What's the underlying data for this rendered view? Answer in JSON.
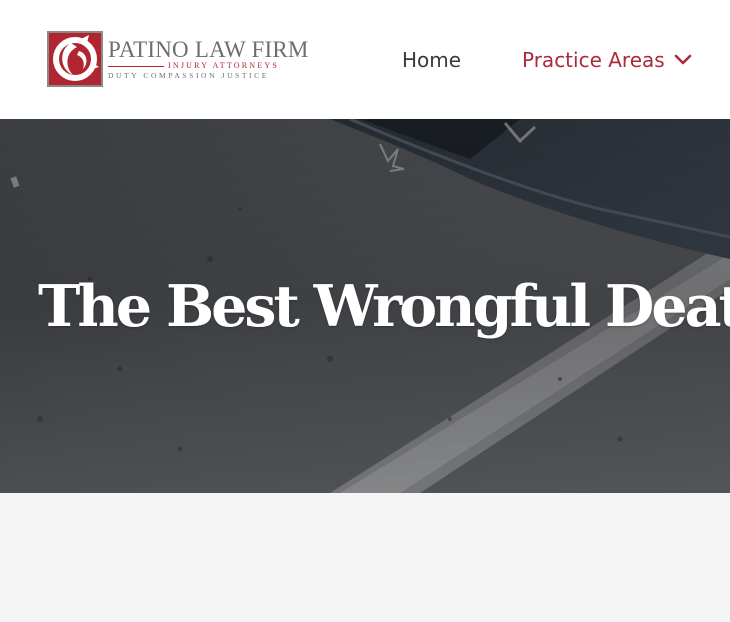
{
  "header": {
    "logo": {
      "firm_name": "PATINO LAW FIRM",
      "subtitle": "INJURY ATTORNEYS",
      "tagline": "DUTY COMPASSION JUSTICE",
      "icon": "dragon-emblem-icon"
    },
    "nav": {
      "home_label": "Home",
      "practice_areas_label": "Practice Areas",
      "practice_areas_icon": "chevron-down-icon"
    }
  },
  "hero": {
    "title": "The Best Wrongful Death Lawyers",
    "background": "asphalt-and-car-photo"
  },
  "colors": {
    "brand_red": "#ab2b3c",
    "nav_text": "#3a3a3a",
    "hero_text": "#ffffff",
    "page_bg": "#f5f5f5"
  }
}
